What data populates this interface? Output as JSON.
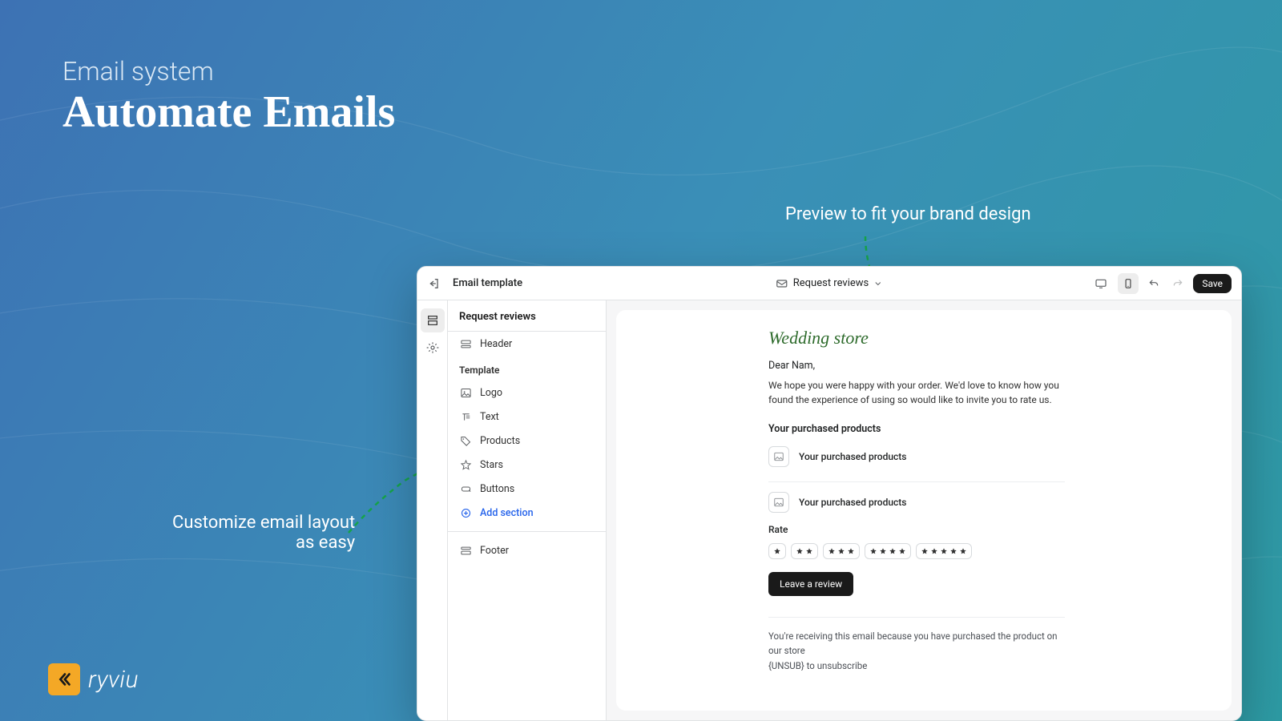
{
  "hero": {
    "eyebrow": "Email system",
    "title": "Automate Emails"
  },
  "annotations": {
    "right": "Preview to fit your brand design",
    "left_line1": "Customize email layout",
    "left_line2": "as easy"
  },
  "brand": {
    "name": "ryviu"
  },
  "editor": {
    "topbar": {
      "title": "Email template",
      "dropdown_label": "Request reviews",
      "save": "Save"
    },
    "side": {
      "heading": "Request reviews",
      "header_row": "Header",
      "template_label": "Template",
      "items": [
        {
          "icon": "image",
          "label": "Logo"
        },
        {
          "icon": "text",
          "label": "Text"
        },
        {
          "icon": "tag",
          "label": "Products"
        },
        {
          "icon": "star",
          "label": "Stars"
        },
        {
          "icon": "button",
          "label": "Buttons"
        }
      ],
      "add_section": "Add section",
      "footer_row": "Footer"
    },
    "preview": {
      "brand": "Wedding store",
      "greeting": "Dear Nam,",
      "body": "We hope you were happy with your order. We'd love to know how you found the experience of using so would like to invite you to rate us.",
      "purchased_title": "Your purchased products",
      "products": [
        {
          "label": "Your purchased products"
        },
        {
          "label": "Your purchased products"
        }
      ],
      "rate_label": "Rate",
      "review_button": "Leave a review",
      "footer_line1": "You're receiving this email because you have purchased the product on our store",
      "footer_line2": "{UNSUB} to unsubscribe"
    }
  }
}
